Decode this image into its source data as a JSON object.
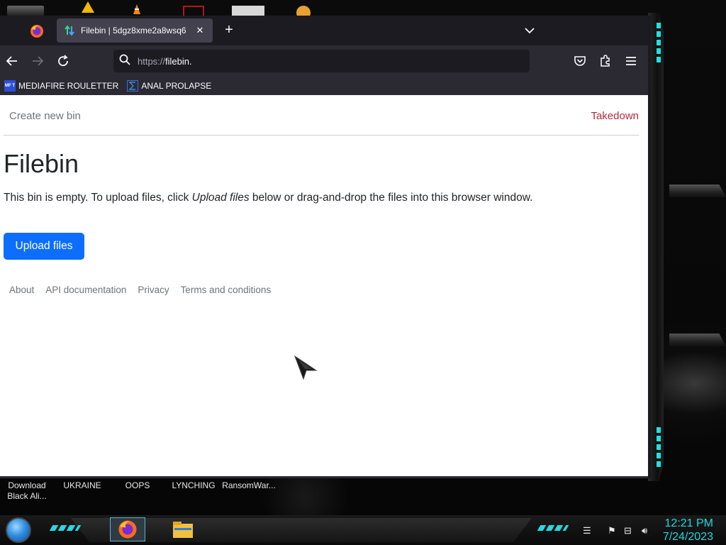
{
  "desktop": {
    "icon_labels": [
      "Download Black Ali...",
      "UKRAINE",
      "OOPS",
      "LYNCHING",
      "RansomWar..."
    ]
  },
  "browser": {
    "tab": {
      "title": "Filebin | 5dgz8xme2a8wsq6"
    },
    "url": {
      "prefix": "https://",
      "host": "filebin."
    },
    "bookmarks": [
      {
        "label": "MEDIAFIRE ROULETTER",
        "icon": "mediafire-icon",
        "icon_text": "MF T"
      },
      {
        "label": "ANAL PROLAPSE",
        "icon": "sigma-icon"
      }
    ]
  },
  "page": {
    "nav": {
      "create_new_bin": "Create new bin",
      "takedown": "Takedown"
    },
    "title": "Filebin",
    "description": {
      "before": "This bin is empty. To upload files, click ",
      "emphasis": "Upload files",
      "after": " below or drag-and-drop the files into this browser window."
    },
    "upload_button": "Upload files",
    "footer_links": [
      "About",
      "API documentation",
      "Privacy",
      "Terms and conditions"
    ]
  },
  "taskbar": {
    "clock_time": "12:21 PM",
    "clock_date": "7/24/2023"
  },
  "colors": {
    "primary_button": "#0d6efd",
    "takedown_link": "#b02a3a",
    "clock": "#22d8e0"
  }
}
